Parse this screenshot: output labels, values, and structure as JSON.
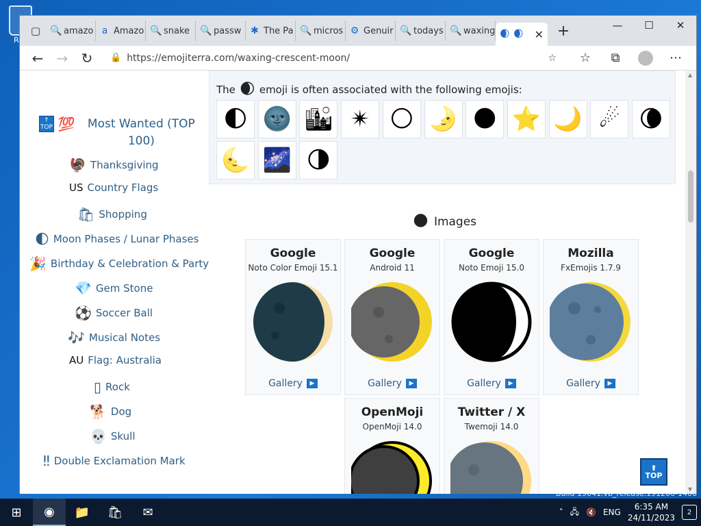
{
  "desktop": {
    "recycle_label": "Rec",
    "build_text": "Build 19041.vb_release.191206-1406"
  },
  "browser": {
    "tabs": [
      {
        "fav": "🔍",
        "label": "amazo"
      },
      {
        "fav": "a",
        "label": "Amazo"
      },
      {
        "fav": "🔍",
        "label": "snake"
      },
      {
        "fav": "🔍",
        "label": "passw"
      },
      {
        "fav": "✱",
        "label": "The Pa"
      },
      {
        "fav": "🔍",
        "label": "micros"
      },
      {
        "fav": "⚙",
        "label": "Genuir"
      },
      {
        "fav": "🔍",
        "label": "todays"
      },
      {
        "fav": "🔍",
        "label": "waxing"
      }
    ],
    "active_tab": {
      "fav": "🌒",
      "close": "✕"
    },
    "url": "https://emojiterra.com/waxing-crescent-moon/"
  },
  "sidebar": {
    "most_wanted": {
      "badge": "TOP",
      "emoji": "💯",
      "label": "Most Wanted (TOP 100)"
    },
    "items": [
      {
        "emoji": "🦃",
        "prefix": "",
        "label": "Thanksgiving"
      },
      {
        "emoji": "",
        "prefix": "US",
        "label": "Country Flags"
      },
      {
        "emoji": "🛍",
        "prefix": "",
        "label": "Shopping"
      },
      {
        "emoji": "🌓",
        "prefix": "",
        "label": "Moon Phases / Lunar Phases"
      },
      {
        "emoji": "🎉",
        "prefix": "",
        "label": "Birthday & Celebration & Party"
      },
      {
        "emoji": "💎",
        "prefix": "",
        "label": "Gem Stone"
      },
      {
        "emoji": "⚽",
        "prefix": "",
        "label": "Soccer Ball"
      },
      {
        "emoji": "🎶",
        "prefix": "",
        "label": "Musical Notes"
      },
      {
        "emoji": "",
        "prefix": "AU",
        "label": "Flag: Australia"
      },
      {
        "emoji": "▯",
        "prefix": "",
        "label": "Rock"
      },
      {
        "emoji": "🐕",
        "prefix": "",
        "label": "Dog"
      },
      {
        "emoji": "💀",
        "prefix": "",
        "label": "Skull"
      },
      {
        "emoji": "‼",
        "prefix": "",
        "label": "Double Exclamation Mark"
      }
    ]
  },
  "related": {
    "text_before": "The",
    "emoji": "🌒",
    "text_after": "emoji is often associated with the following emojis:",
    "emojis": [
      "🌓",
      "🌚",
      "🏙",
      "✴",
      "🌕",
      "🌛",
      "🌑",
      "⭐",
      "🌙",
      "☄",
      "🌘",
      "🌜",
      "🌌",
      "🌗"
    ]
  },
  "images": {
    "heading": "Images",
    "emoji": "🌑",
    "cards": [
      {
        "vendor": "Google",
        "version": "Noto Color Emoji 15.1",
        "gallery": "Gallery",
        "style": "noto-color"
      },
      {
        "vendor": "Google",
        "version": "Android 11",
        "gallery": "Gallery",
        "style": "android"
      },
      {
        "vendor": "Google",
        "version": "Noto Emoji 15.0",
        "gallery": "Gallery",
        "style": "noto-bw"
      },
      {
        "vendor": "Mozilla",
        "version": "FxEmojis 1.7.9",
        "gallery": "Gallery",
        "style": "mozilla"
      },
      {
        "vendor": "OpenMoji",
        "version": "OpenMoji 14.0",
        "style": "openmoji"
      },
      {
        "vendor": "Twitter / X",
        "version": "Twemoji 14.0",
        "style": "twemoji"
      }
    ]
  },
  "top_button": {
    "arrow": "⬆",
    "label": "TOP"
  },
  "taskbar": {
    "language": "ENG",
    "time": "6:35 AM",
    "date": "24/11/2023",
    "notifications": "2"
  }
}
